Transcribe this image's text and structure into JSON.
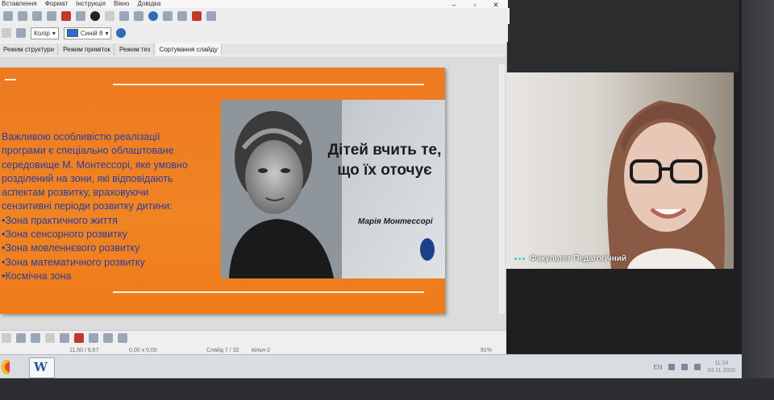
{
  "menubar": {
    "items": [
      "Вставлення",
      "Формат",
      "Інструкція",
      "Вікно",
      "Довідка"
    ]
  },
  "toolbar2": {
    "color_mode": "Колір",
    "color_name": "Синій 8"
  },
  "tabs": [
    "Режим структури",
    "Режим приміток",
    "Режим тез",
    "Сортування слайду"
  ],
  "slide": {
    "body_lines": [
      "Важливою особливістю реалізації",
      "програми є спеціально облаштоване",
      "середовище М. Монтессорі, яке умовно",
      "розділений на зони, які відповідають",
      "аспектам розвитку, враховуючи",
      "сензитивні періоди розвитку дитини:"
    ],
    "bullets": [
      "•Зона практичного життя",
      "•Зона сенсорного розвитку",
      "•Зона мовленнєвого розвитку",
      "•Зона математичного розвитку",
      "•Космічна зона"
    ],
    "quote_line1": "Дітей вчить те,",
    "quote_line2": "що їх оточує",
    "quote_author": "Марія Монтессорі"
  },
  "statusbar": {
    "position": "11,50 / 8,67",
    "size": "0,00 x 0,00",
    "slide": "Слайд 7 / 32",
    "layout": "вільн-2",
    "zoom": "91%"
  },
  "video": {
    "participant_name": "Факультет Педагогічний"
  },
  "taskbar": {
    "tray_lang": "EN",
    "time": "11:24",
    "date": "03.11.2020"
  },
  "colors": {
    "slide_orange": "#f07b1c",
    "slide_text_blue": "#2b3e9c",
    "accent_teal": "#3fc8d8"
  }
}
